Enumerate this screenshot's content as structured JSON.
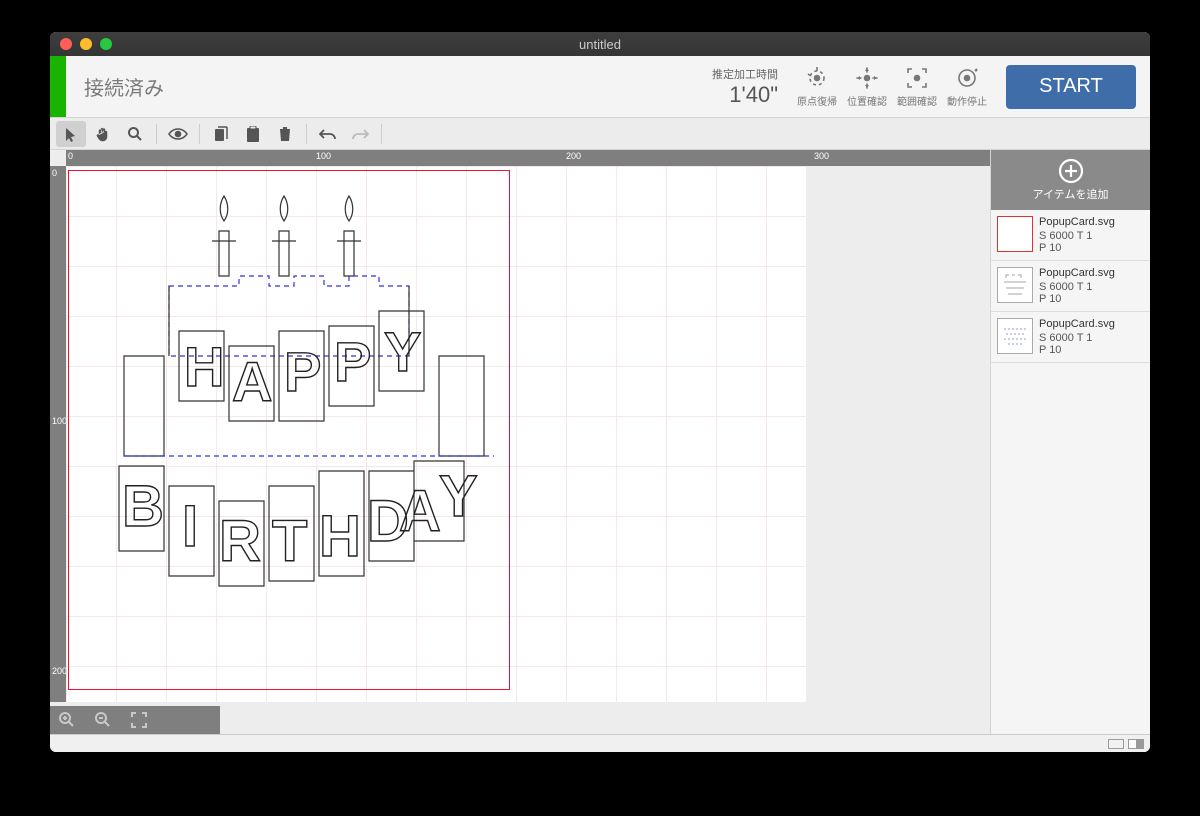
{
  "window": {
    "title": "untitled"
  },
  "header": {
    "status": "接続済み",
    "est_label": "推定加工時間",
    "est_value": "1'40\"",
    "buttons": [
      {
        "id": "origin-return",
        "label": "原点復帰"
      },
      {
        "id": "position-check",
        "label": "位置確認"
      },
      {
        "id": "range-check",
        "label": "範囲確認"
      },
      {
        "id": "stop",
        "label": "動作停止"
      }
    ],
    "start": "START"
  },
  "toolbar": {
    "tools": [
      "select",
      "pan",
      "zoom",
      "preview",
      "copy",
      "paste",
      "delete",
      "undo",
      "redo"
    ]
  },
  "ruler": {
    "h": [
      "0",
      "100",
      "200",
      "300"
    ],
    "v": [
      "0",
      "100",
      "200"
    ]
  },
  "sidebar": {
    "add_label": "アイテムを追加",
    "items": [
      {
        "name": "PopupCard.svg",
        "line1": "S 6000  T 1",
        "line2": "P 10"
      },
      {
        "name": "PopupCard.svg",
        "line1": "S 6000  T 1",
        "line2": "P 10"
      },
      {
        "name": "PopupCard.svg",
        "line1": "S 6000  T 1",
        "line2": "P 10"
      }
    ]
  },
  "design": {
    "label": "HAPPY BIRTHDAY popup card"
  }
}
